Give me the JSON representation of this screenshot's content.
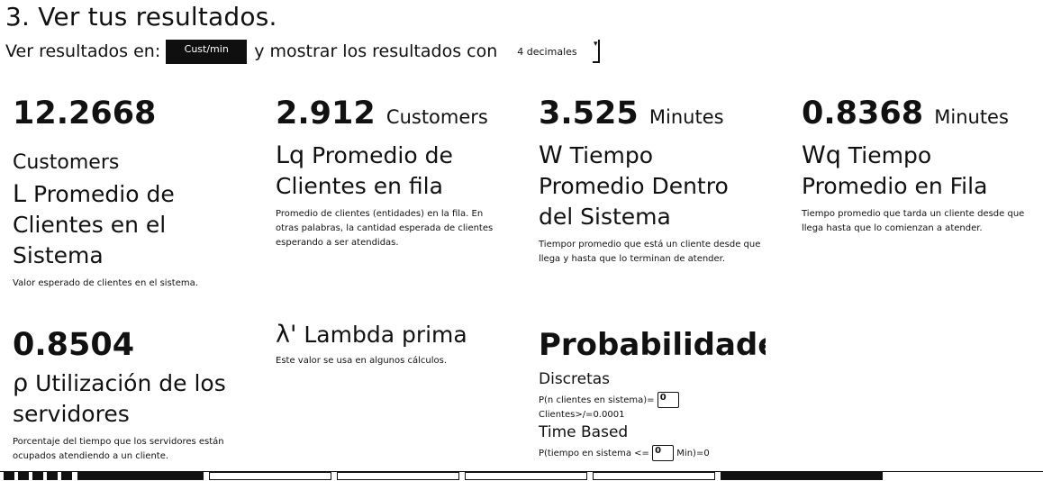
{
  "section_title": "3. Ver tus resultados.",
  "settings": {
    "view_label": "Ver resultados en:",
    "unit_value": "Cust/min",
    "show_label": "y mostrar los resultados con",
    "decimals_value": "4 decimales"
  },
  "metrics": {
    "L": {
      "value": "12.2668",
      "unit": "Customers",
      "symbol": "L",
      "name": "Promedio de Clientes en el Sistema",
      "desc": "Valor esperado de clientes en el sistema."
    },
    "Lq": {
      "value": "2.912",
      "unit": "Customers",
      "symbol": "Lq",
      "name": "Promedio de Clientes en fila",
      "desc": "Promedio de clientes (entidades) en la fila. En otras palabras, la cantidad esperada de clientes esperando a ser atendidas."
    },
    "W": {
      "value": "3.525",
      "unit": "Minutes",
      "symbol": "W",
      "name": "Tiempo Promedio Dentro del Sistema",
      "desc": "Tiempor promedio que está un cliente desde que llega y hasta que lo terminan de atender."
    },
    "Wq": {
      "value": "0.8368",
      "unit": "Minutes",
      "symbol": "Wq",
      "name": "Tiempo Promedio en Fila",
      "desc": "Tiempo promedio que tarda un cliente desde que llega hasta que lo comienzan a atender."
    },
    "rho": {
      "value": "0.8504",
      "symbol": "ρ",
      "name": "Utilización de los servidores",
      "desc": "Porcentaje del tiempo que los servidores están ocupados atendiendo a un cliente."
    },
    "lambda": {
      "symbol": "λ'",
      "name": "Lambda prima",
      "desc": "Este valor se usa en algunos cálculos."
    }
  },
  "probabilities": {
    "title": "Probabilidades",
    "discrete_label": "Discretas",
    "p_n_label": "P(n clientes en sistema)=",
    "p_n_input": "0",
    "clients_line": "Clientes>/=0.0001",
    "time_label": "Time Based",
    "p_t_label": "P(tiempo en sistema <=",
    "p_t_input": "0",
    "p_t_suffix": "Min)=0"
  }
}
